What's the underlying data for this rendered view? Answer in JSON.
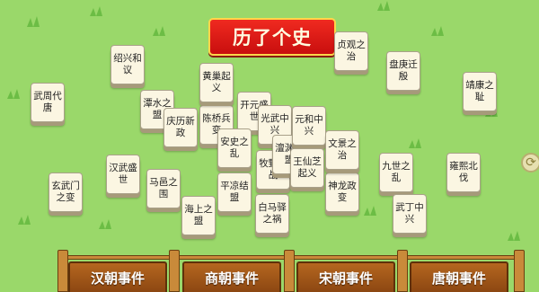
{
  "title": "历了个史",
  "tiles": [
    {
      "text": "武周代唐"
    },
    {
      "text": "玄武门之变"
    },
    {
      "text": "绍兴和议"
    },
    {
      "text": "潭水之盟"
    },
    {
      "text": "汉武盛世"
    },
    {
      "text": "马邑之围"
    },
    {
      "text": "庆历新政"
    },
    {
      "text": "黄巢起义"
    },
    {
      "text": "陈桥兵变"
    },
    {
      "text": "安史之乱"
    },
    {
      "text": "平凉结盟"
    },
    {
      "text": "海上之盟"
    },
    {
      "text": "开元盛世"
    },
    {
      "text": "光武中兴"
    },
    {
      "text": "牧野之战"
    },
    {
      "text": "白马驿之祸"
    },
    {
      "text": "澶渊之盟"
    },
    {
      "text": "元和中兴"
    },
    {
      "text": "王仙芝起义"
    },
    {
      "text": "神龙政变"
    },
    {
      "text": "文景之治"
    },
    {
      "text": "贞观之治"
    },
    {
      "text": "盘庚迁殷"
    },
    {
      "text": "九世之乱"
    },
    {
      "text": "武丁中兴"
    },
    {
      "text": "靖康之耻"
    },
    {
      "text": "雍熙北伐"
    }
  ],
  "categories": [
    {
      "label": "汉朝事件"
    },
    {
      "label": "商朝事件"
    },
    {
      "label": "宋朝事件"
    },
    {
      "label": "唐朝事件"
    }
  ],
  "side_button_icon": "refresh-icon",
  "colors": {
    "background": "#9ad86a",
    "banner": "#e0161a",
    "fence": "#a85a1c"
  }
}
